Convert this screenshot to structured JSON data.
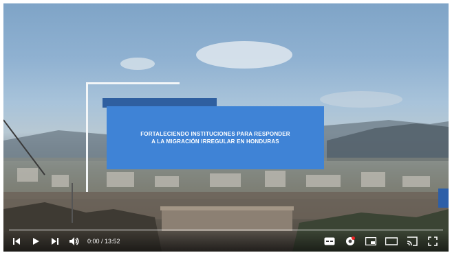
{
  "video": {
    "title_text": "FORTALECIENDO INSTITUCIONES PARA RESPONDER\nA LA MIGRACIÓN IRREGULAR EN HONDURAS",
    "progress_fraction": 0.0
  },
  "controls": {
    "time_display": "0:00 / 13:52",
    "icons": [
      "previous-icon",
      "play-icon",
      "next-icon",
      "volume-icon",
      "subtitles-icon",
      "settings-icon",
      "miniplayer-icon",
      "theater-mode-icon",
      "cast-icon",
      "fullscreen-icon"
    ]
  },
  "colors": {
    "title_box": "#3f83d6",
    "title_back": "#2f5fa0",
    "progress": "#ff0000"
  }
}
